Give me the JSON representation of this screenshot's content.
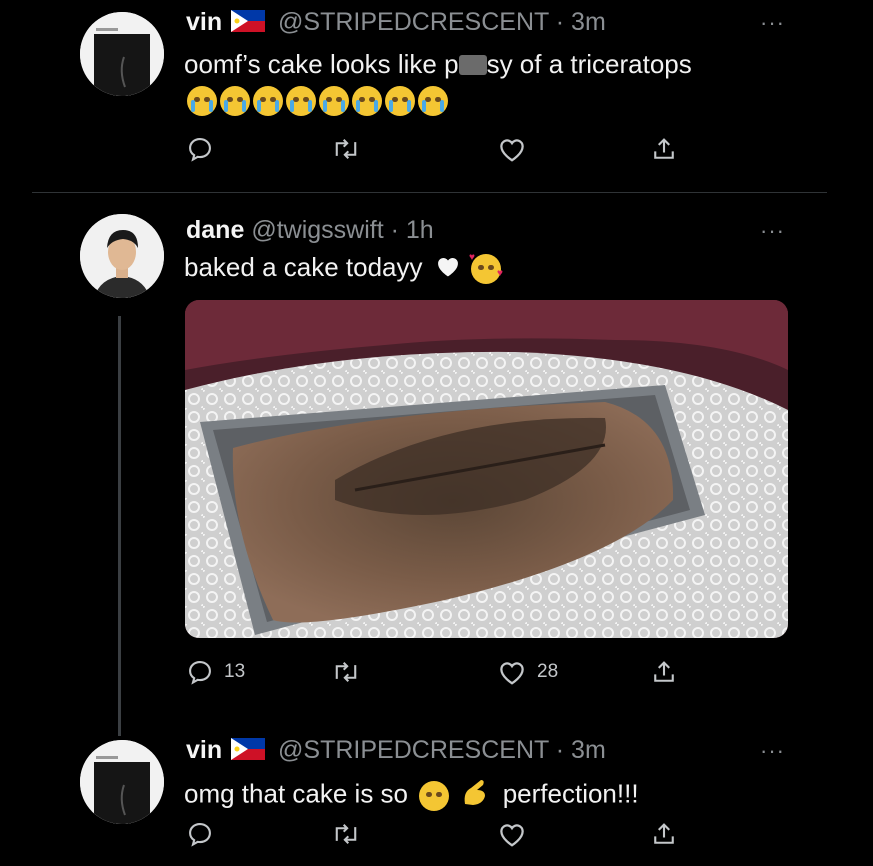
{
  "tweets": [
    {
      "name": "vin",
      "handle": "@STRIPEDCRESCENT",
      "time": "· 3m",
      "text_before": "oomf’s cake looks like p",
      "text_after": "sy of a triceratops",
      "emoji_count": 8,
      "actions": {
        "reply_count": "",
        "retweet_count": "",
        "like_count": ""
      }
    },
    {
      "name": "dane",
      "handle": "@twigsswift",
      "time": "· 1h",
      "text": "baked a cake todayy",
      "actions": {
        "reply_count": "13",
        "retweet_count": "",
        "like_count": "28"
      }
    },
    {
      "name": "vin",
      "handle": "@STRIPEDCRESCENT",
      "time": "· 3m",
      "text_before": "omg that cake is so",
      "text_after": "perfection!!!",
      "actions": {
        "reply_count": "",
        "retweet_count": "",
        "like_count": ""
      }
    }
  ],
  "more_label": "···",
  "colors": {
    "background": "#000000",
    "text": "#e7e9ea",
    "muted": "#8b8f93",
    "divider": "#2f3336"
  }
}
